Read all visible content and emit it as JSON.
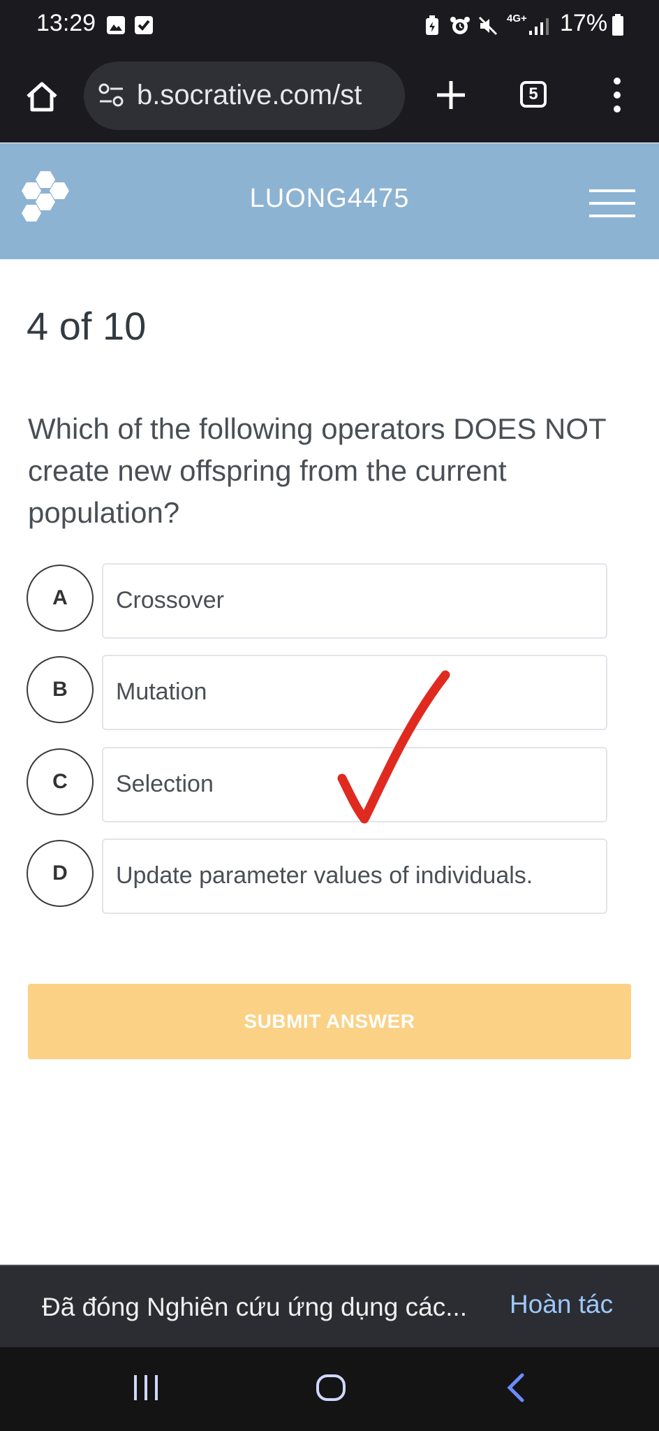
{
  "status_bar": {
    "time": "13:29",
    "network": "4G+",
    "battery": "17%"
  },
  "browser": {
    "url": "b.socrative.com/st",
    "tab_count": "5"
  },
  "app": {
    "room_name": "LUONG4475",
    "accent_color": "#8db3d3"
  },
  "quiz": {
    "progress": "4 of 10",
    "question": "Which of the following operators DOES NOT create new offspring from the current population?",
    "choices": [
      {
        "letter": "A",
        "text": "Crossover"
      },
      {
        "letter": "B",
        "text": "Mutation"
      },
      {
        "letter": "C",
        "text": "Selection"
      },
      {
        "letter": "D",
        "text": "Update parameter values of individuals."
      }
    ],
    "submit_label": "SUBMIT ANSWER",
    "submit_color": "#fbd185"
  },
  "snackbar": {
    "message": "Đã đóng Nghiên cứu ứng dụng các...",
    "action": "Hoàn tác"
  }
}
